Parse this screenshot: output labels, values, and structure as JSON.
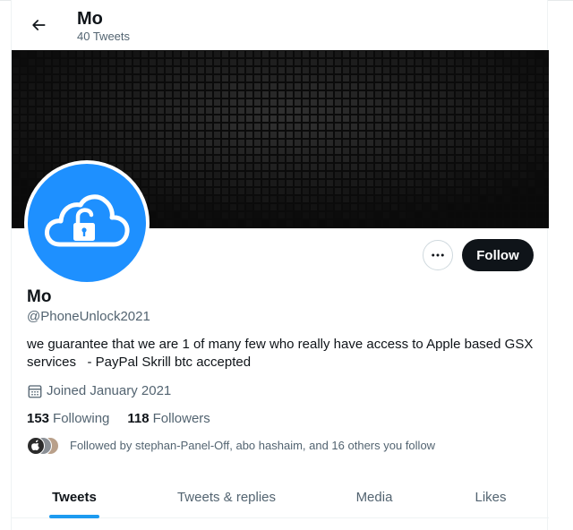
{
  "header": {
    "title": "Mo",
    "tweet_count": "40 Tweets",
    "back_icon": "arrow-left-icon"
  },
  "banner": {
    "description_colors": {
      "background": "#0b0b0b",
      "tile": "#262626"
    }
  },
  "avatar": {
    "icon": "cloud-unlock-icon",
    "colors": {
      "background": "#1e90ff",
      "glyph": "#ffffff"
    }
  },
  "actions": {
    "more_icon": "more-horizontal-icon",
    "follow_label": "Follow"
  },
  "profile": {
    "name": "Mo",
    "handle": "@PhoneUnlock2021",
    "bio": "we guarantee that we are 1 of many few who really have access to Apple based GSX services   - PayPal Skrill btc accepted",
    "joined": "Joined January 2021",
    "calendar_icon": "calendar-icon"
  },
  "stats": {
    "following_count": "153",
    "following_label": "Following",
    "followers_count": "118",
    "followers_label": "Followers"
  },
  "followed_by": {
    "text": "Followed by stephan-Panel-Off, abo hashaim, and 16 others you follow"
  },
  "tabs": [
    {
      "label": "Tweets",
      "active": true
    },
    {
      "label": "Tweets & replies",
      "active": false
    },
    {
      "label": "Media",
      "active": false
    },
    {
      "label": "Likes",
      "active": false
    }
  ],
  "colors": {
    "accent": "#1d9bf0",
    "text_primary": "#0f1419",
    "text_secondary": "#536471",
    "follow_button_bg": "#0f1419"
  }
}
